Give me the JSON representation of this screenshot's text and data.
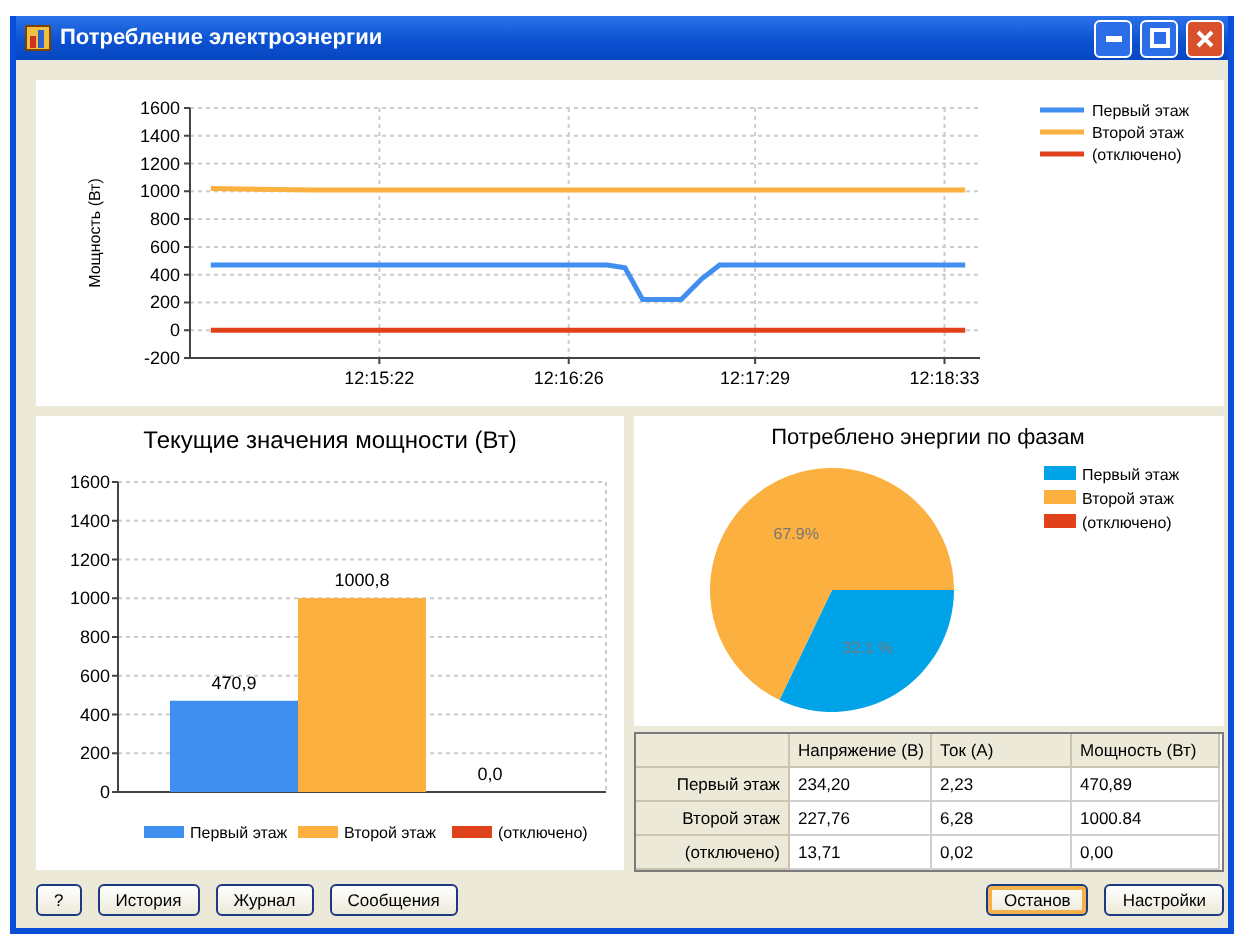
{
  "window": {
    "title": "Потребление электроэнергии"
  },
  "power_chart": {
    "chart_data": {
      "type": "line",
      "ylabel": "Мощность (Вт)",
      "grid": true,
      "legend": "right",
      "xlim": [
        44058,
        44325
      ],
      "ylim": [
        -200,
        1600
      ],
      "yticks": [
        -200,
        0,
        200,
        400,
        600,
        800,
        1000,
        1200,
        1400,
        1600
      ],
      "xticks": [
        {
          "value": 44122,
          "label": "12:15:22"
        },
        {
          "value": 44186,
          "label": "12:16:26"
        },
        {
          "value": 44249,
          "label": "12:17:29"
        },
        {
          "value": 44313,
          "label": "12:18:33"
        }
      ],
      "x": [
        44065,
        44100,
        44140,
        44180,
        44199,
        44205,
        44211,
        44224,
        44231,
        44237,
        44270,
        44320
      ],
      "series": [
        {
          "name": "Первый этаж",
          "color": "#3f8ef0",
          "values": [
            470,
            470,
            470,
            470,
            470,
            450,
            220,
            220,
            370,
            470,
            470,
            470
          ]
        },
        {
          "name": "Второй этаж",
          "color": "#fbb040",
          "values": [
            1020,
            1010,
            1010,
            1010,
            1010,
            1010,
            1010,
            1010,
            1010,
            1010,
            1010,
            1010
          ]
        },
        {
          "name": "(отключено)",
          "color": "#e0401a",
          "values": [
            0,
            0,
            0,
            0,
            0,
            0,
            0,
            0,
            0,
            0,
            0,
            0
          ]
        }
      ]
    }
  },
  "current_chart": {
    "chart_data": {
      "type": "bar",
      "title": "Текущие значения мощности (Вт)",
      "grid": true,
      "legend": "bottom",
      "ylim": [
        0,
        1600
      ],
      "yticks": [
        0,
        200,
        400,
        600,
        800,
        1000,
        1200,
        1400,
        1600
      ],
      "series": [
        {
          "name": "Первый этаж",
          "color": "#3f8ef0",
          "values": [
            470.9
          ]
        },
        {
          "name": "Второй этаж",
          "color": "#fbb040",
          "values": [
            1000.8
          ]
        },
        {
          "name": "(отключено)",
          "color": "#e0401a",
          "values": [
            0.0
          ]
        }
      ],
      "value_labels": [
        "470,9",
        "1000,8",
        "0,0"
      ]
    }
  },
  "energy_chart": {
    "chart_data": {
      "type": "pie",
      "title": "Потреблено энергии по фазам",
      "legend": "right",
      "categories": [
        "Первый этаж",
        "Второй этаж",
        "(отключено)"
      ],
      "values": [
        32.1,
        67.9,
        0
      ],
      "colors": [
        "#00a2e8",
        "#fbb040",
        "#e0401a"
      ],
      "value_labels": [
        "32.1 %",
        "67.9%",
        null
      ]
    }
  },
  "table": {
    "columns": [
      "Напряжение (В)",
      "Ток (А)",
      "Мощность (Вт)"
    ],
    "rows": [
      {
        "name": "Первый этаж",
        "cells": [
          "234,20",
          "2,23",
          "470,89"
        ]
      },
      {
        "name": "Второй этаж",
        "cells": [
          "227,76",
          "6,28",
          "1000.84"
        ]
      },
      {
        "name": "(отключено)",
        "cells": [
          "13,71",
          "0,02",
          "0,00"
        ]
      }
    ]
  },
  "buttons_left": [
    {
      "label": "?",
      "default": false
    },
    {
      "label": "История",
      "default": false
    },
    {
      "label": "Журнал",
      "default": false
    },
    {
      "label": "Сообщения",
      "default": false
    }
  ],
  "buttons_right": [
    {
      "label": "Останов",
      "default": true
    },
    {
      "label": "Настройки",
      "default": false
    }
  ]
}
